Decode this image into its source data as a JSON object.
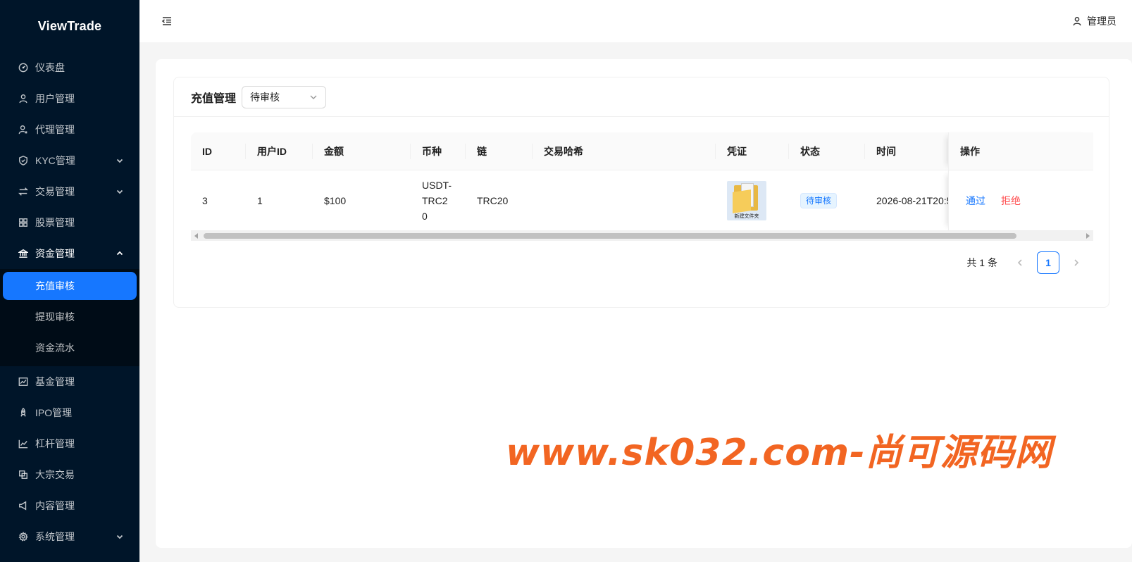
{
  "sidebar": {
    "logo": "ViewTrade",
    "items": [
      {
        "label": "仪表盘"
      },
      {
        "label": "用户管理"
      },
      {
        "label": "代理管理"
      },
      {
        "label": "KYC管理"
      },
      {
        "label": "交易管理"
      },
      {
        "label": "股票管理"
      },
      {
        "label": "资金管理"
      },
      {
        "label": "基金管理"
      },
      {
        "label": "IPO管理"
      },
      {
        "label": "杠杆管理"
      },
      {
        "label": "大宗交易"
      },
      {
        "label": "内容管理"
      },
      {
        "label": "系统管理"
      }
    ],
    "funds_submenu": [
      {
        "label": "充值审核"
      },
      {
        "label": "提现审核"
      },
      {
        "label": "资金流水"
      }
    ]
  },
  "header": {
    "user_name": "管理员"
  },
  "card": {
    "title": "充值管理",
    "status_filter": "待审核"
  },
  "table": {
    "columns": [
      "ID",
      "用户ID",
      "金额",
      "币种",
      "链",
      "交易哈希",
      "凭证",
      "状态",
      "时间",
      "操作"
    ],
    "rows": [
      {
        "id": "3",
        "user_id": "1",
        "amount": "$100",
        "currency": "USDT-TRC20",
        "chain": "TRC20",
        "tx_hash": "",
        "voucher_label": "新建文件夹",
        "status": "待审核",
        "time": "2026-08-21T20:5",
        "approve": "通过",
        "reject": "拒绝"
      }
    ]
  },
  "pagination": {
    "total": "共 1 条",
    "current_page": "1"
  },
  "watermark": "www.sk032.com-尚可源码网",
  "colors": {
    "sidebar_bg": "#001529",
    "primary": "#1677ff",
    "danger": "#ff4d4f",
    "watermark": "#f26522"
  }
}
